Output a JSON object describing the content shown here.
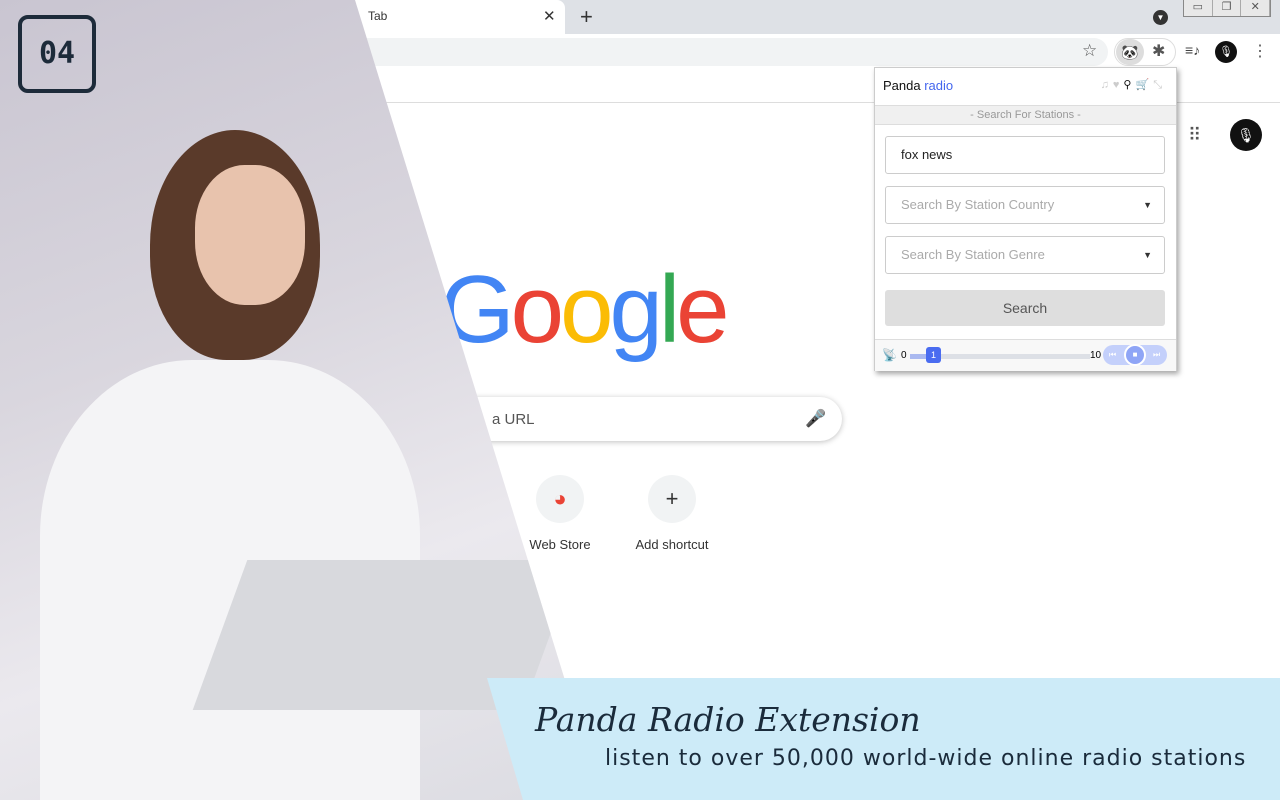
{
  "browser": {
    "tab_title": "Tab",
    "tab_close": "✕",
    "new_tab": "+",
    "window_controls": [
      "▭",
      "❐",
      "✕"
    ]
  },
  "toolbar": {
    "star": "☆",
    "panda": "🐼",
    "puzzle": "✱",
    "media": "≡♪",
    "menu": "⋮",
    "avatar": "🎙"
  },
  "page": {
    "google": [
      {
        "ch": "G",
        "color": "#4285f4"
      },
      {
        "ch": "o",
        "color": "#ea4335"
      },
      {
        "ch": "o",
        "color": "#fbbc05"
      },
      {
        "ch": "g",
        "color": "#4285f4"
      },
      {
        "ch": "l",
        "color": "#34a853"
      },
      {
        "ch": "e",
        "color": "#ea4335"
      }
    ],
    "search_placeholder": "a URL",
    "apps": "⠿",
    "shortcuts": [
      {
        "label": "Web Store",
        "icon": "◕"
      },
      {
        "label": "Add shortcut",
        "icon": "+"
      }
    ]
  },
  "popup": {
    "title": "Panda",
    "title_accent": "radio",
    "subtitle": "- Search For Stations -",
    "query": "fox news",
    "country_placeholder": "Search By Station Country",
    "genre_placeholder": "Search By Station Genre",
    "search_button": "Search",
    "volume_min": "0",
    "volume_max": "10",
    "volume_value": "1",
    "icons": [
      "music",
      "heart",
      "search",
      "cart",
      "collapse"
    ],
    "accent": "#4a6cf0"
  },
  "badge": "04",
  "banner": {
    "title": "Panda Radio Extension",
    "subtitle": "listen to over 50,000 world-wide online radio stations"
  }
}
